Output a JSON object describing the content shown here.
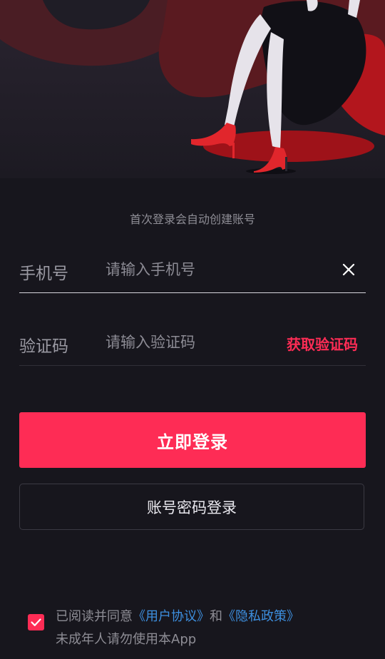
{
  "hint": "首次登录会自动创建账号",
  "phone": {
    "label": "手机号",
    "placeholder": "请输入手机号",
    "value": ""
  },
  "code": {
    "label": "验证码",
    "placeholder": "请输入验证码",
    "value": "",
    "get_code": "获取验证码"
  },
  "login_button": "立即登录",
  "password_login_button": "账号密码登录",
  "agreement": {
    "checked": true,
    "prefix": "已阅读并同意",
    "user_agreement": "《用户协议》",
    "and": "和",
    "privacy_policy": "《隐私政策》",
    "minor_notice": "未成年人请勿使用本App"
  },
  "colors": {
    "accent": "#fe2c55",
    "link": "#3d8fdf",
    "background": "#17161d"
  },
  "icons": {
    "clear": "close-icon",
    "checkbox": "checkmark-icon"
  }
}
